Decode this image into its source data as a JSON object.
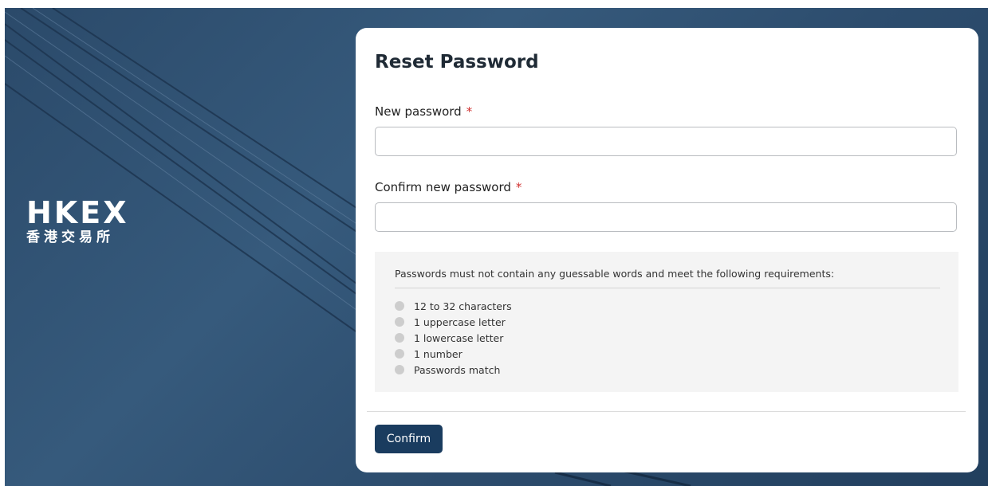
{
  "brand": {
    "name": "HKEX",
    "subtitle": "香港交易所"
  },
  "form": {
    "title": "Reset Password",
    "new_password_label": "New password",
    "confirm_password_label": "Confirm new password",
    "required_marker": "*",
    "new_password_value": "",
    "confirm_password_value": ""
  },
  "requirements": {
    "intro": "Passwords must not contain any guessable words and meet the following requirements:",
    "items": [
      {
        "label": "12 to 32 characters",
        "met": false
      },
      {
        "label": "1 uppercase letter",
        "met": false
      },
      {
        "label": "1 lowercase letter",
        "met": false
      },
      {
        "label": "1 number",
        "met": false
      },
      {
        "label": "Passwords match",
        "met": false
      }
    ]
  },
  "actions": {
    "confirm_label": "Confirm"
  },
  "colors": {
    "primary": "#1a3c5f",
    "required": "#d0302f",
    "requirement_unmet": "#cdcdcd"
  }
}
